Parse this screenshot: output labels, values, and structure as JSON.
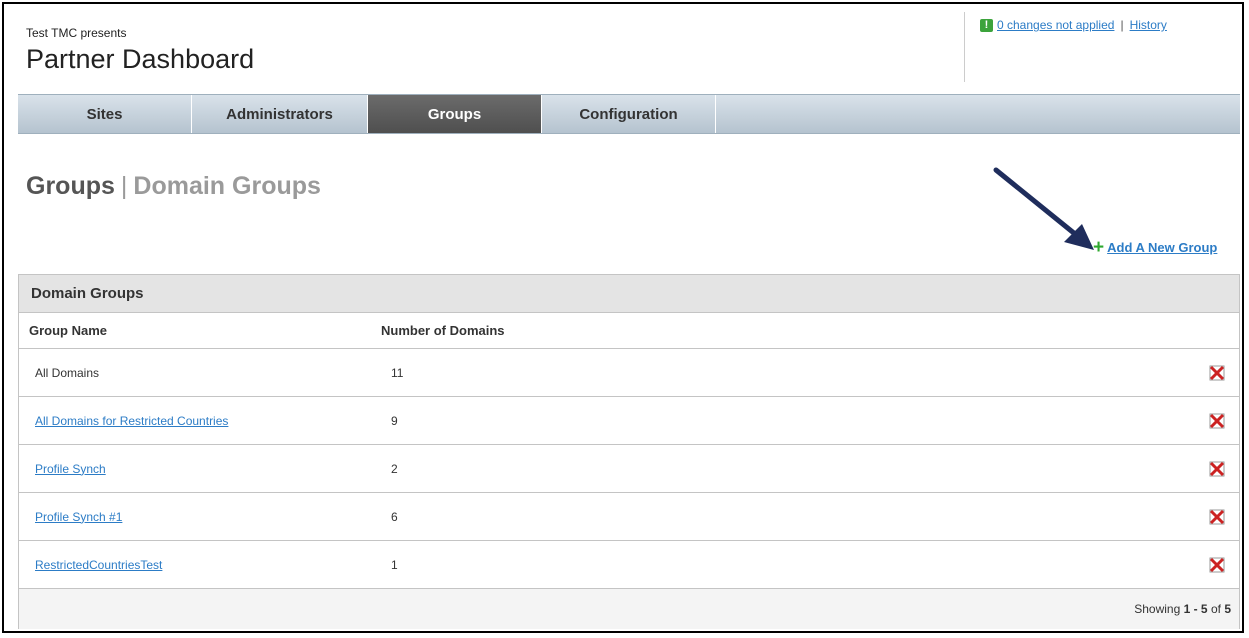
{
  "header": {
    "presents": "Test TMC presents",
    "title": "Partner Dashboard",
    "changes_count_text": "0 changes not applied",
    "separator": "|",
    "history_label": "History"
  },
  "tabs": [
    {
      "label": "Sites",
      "active": false
    },
    {
      "label": "Administrators",
      "active": false
    },
    {
      "label": "Groups",
      "active": true
    },
    {
      "label": "Configuration",
      "active": false
    }
  ],
  "page": {
    "heading_main": "Groups",
    "heading_separator": "|",
    "heading_sub": "Domain Groups",
    "add_link_label": "Add A New Group"
  },
  "table": {
    "panel_title": "Domain Groups",
    "columns": [
      "Group Name",
      "Number of Domains"
    ],
    "rows": [
      {
        "name": "All Domains",
        "count": "11",
        "is_link": false
      },
      {
        "name": "All Domains for Restricted Countries",
        "count": "9",
        "is_link": true
      },
      {
        "name": "Profile Synch",
        "count": "2",
        "is_link": true
      },
      {
        "name": "Profile Synch #1",
        "count": "6",
        "is_link": true
      },
      {
        "name": "RestrictedCountriesTest",
        "count": "1",
        "is_link": true
      }
    ],
    "footer": {
      "prefix": "Showing",
      "range": "1 - 5",
      "of_text": "of",
      "total": "5"
    }
  },
  "colors": {
    "link": "#2c7cc6",
    "active_tab": "#5a5a5a",
    "add_plus": "#2fa82f",
    "delete_icon": "#cc2222",
    "arrow": "#1f2d5c",
    "status_badge": "#3ca33c"
  },
  "icons": {
    "status": "exclamation-icon",
    "add": "plus-icon",
    "delete": "delete-x-icon",
    "pointer": "arrow-icon"
  }
}
